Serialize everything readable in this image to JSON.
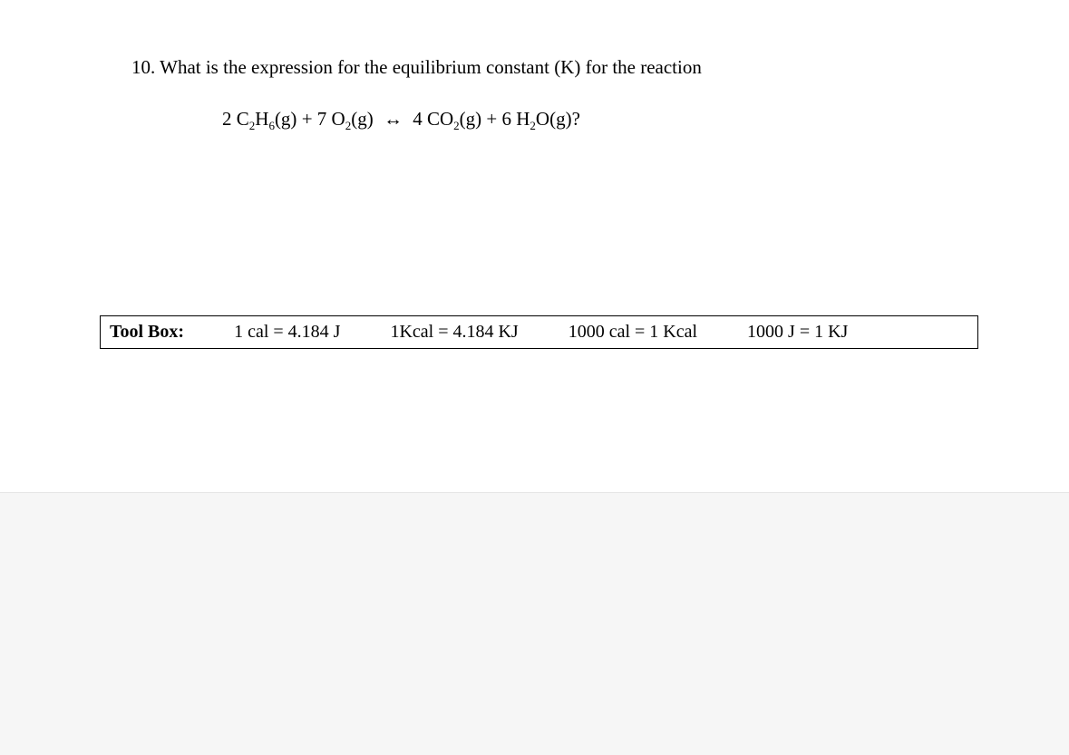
{
  "question": {
    "number": "10.",
    "text": "What is the expression for the equilibrium constant (K) for the reaction",
    "equation_parts": {
      "reactant1_coef": "2 ",
      "reactant1_c": "C",
      "reactant1_sub1": "2",
      "reactant1_h": "H",
      "reactant1_sub2": "6",
      "reactant1_state": "(g)",
      "plus1": " + ",
      "reactant2_coef": "7 ",
      "reactant2_o": "O",
      "reactant2_sub": "2",
      "reactant2_state": "(g)",
      "arrow": "↔",
      "product1_coef": "4 ",
      "product1_co": "CO",
      "product1_sub": "2",
      "product1_state": "(g)",
      "plus2": " + ",
      "product2_coef": "6 ",
      "product2_h": "H",
      "product2_sub": "2",
      "product2_o": "O",
      "product2_state": "(g)?",
      "spacer": "  "
    }
  },
  "toolbox": {
    "label": "Tool Box:",
    "item1": "1 cal = 4.184 J",
    "item2": "1Kcal = 4.184 KJ",
    "item3": "1000 cal = 1 Kcal",
    "item4": "1000 J = 1 KJ"
  }
}
